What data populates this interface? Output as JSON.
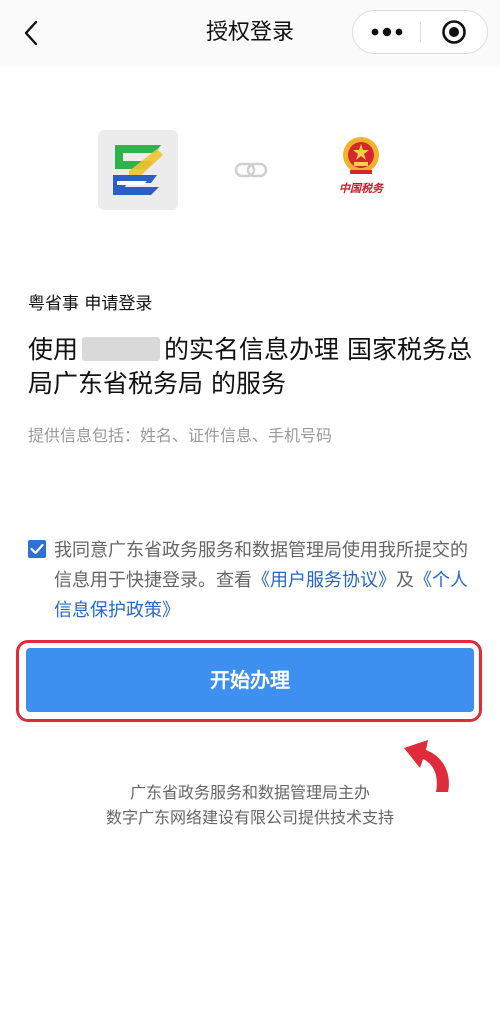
{
  "header": {
    "title": "授权登录",
    "back_icon": "chevron-left-icon",
    "more_icon": "more-dots-icon",
    "close_icon": "target-close-icon"
  },
  "logos": {
    "app_logo": "yue-sheng-shi-logo",
    "link_icon": "link-icon",
    "tax_logo_text": "中国税务"
  },
  "request": {
    "requester": "粤省事 申请登录",
    "headline_prefix": "使用",
    "headline_suffix": "的实名信息办理 国家税务总局广东省税务局 的服务",
    "info": "提供信息包括：姓名、证件信息、手机号码"
  },
  "agreement": {
    "checked": true,
    "text": "我同意广东省政务服务和数据管理局使用我所提交的信息用于快捷登录。查看",
    "link_service": "《用户服务协议》",
    "connector": "及",
    "link_privacy": "《个人信息保护政策》"
  },
  "start_button": {
    "label": "开始办理"
  },
  "footer": {
    "line1": "广东省政务服务和数据管理局主办",
    "line2": "数字广东网络建设有限公司提供技术支持"
  },
  "colors": {
    "primary": "#3d8ff0",
    "link": "#2a66c8",
    "highlight": "#e02b3a"
  }
}
